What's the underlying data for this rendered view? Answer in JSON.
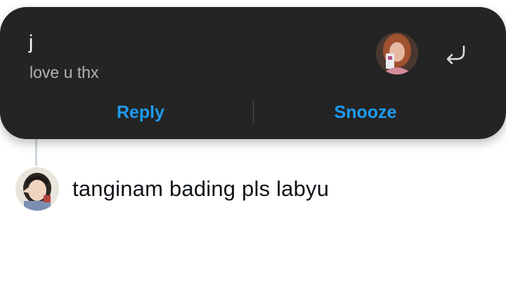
{
  "notification": {
    "sender": "j",
    "message": "love u thx",
    "avatar_icon": "profile-photo",
    "reply_icon": "reply-arrow-icon",
    "actions": {
      "reply_label": "Reply",
      "snooze_label": "Snooze"
    },
    "accent_color": "#1d9bf0",
    "background_color": "#242424"
  },
  "tweet": {
    "text": "tanginam bading pls labyu",
    "avatar_icon": "profile-photo"
  }
}
